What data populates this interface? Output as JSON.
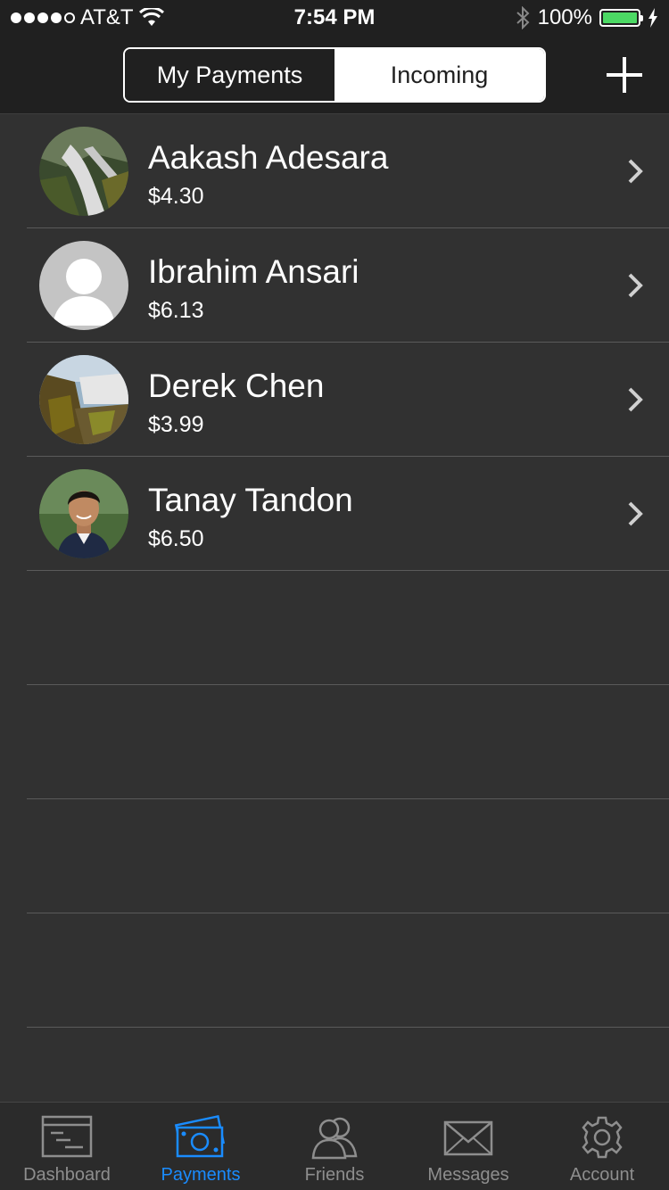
{
  "status_bar": {
    "carrier": "AT&T",
    "time": "7:54 PM",
    "battery": "100%",
    "battery_level": 1.0
  },
  "nav": {
    "segments": [
      "My Payments",
      "Incoming"
    ],
    "selected_segment": "Incoming",
    "add_icon": "plus-icon"
  },
  "payments": [
    {
      "name": "Aakash Adesara",
      "amount": "$4.30",
      "avatar": "waterfall-photo"
    },
    {
      "name": "Ibrahim Ansari",
      "amount": "$6.13",
      "avatar": "default-person"
    },
    {
      "name": "Derek Chen",
      "amount": "$3.99",
      "avatar": "waterfall-photo"
    },
    {
      "name": "Tanay Tandon",
      "amount": "$6.50",
      "avatar": "person-photo"
    }
  ],
  "tabs": [
    {
      "label": "Dashboard",
      "icon": "dashboard-icon",
      "active": false
    },
    {
      "label": "Payments",
      "icon": "payments-icon",
      "active": true
    },
    {
      "label": "Friends",
      "icon": "friends-icon",
      "active": false
    },
    {
      "label": "Messages",
      "icon": "messages-icon",
      "active": false
    },
    {
      "label": "Account",
      "icon": "gear-icon",
      "active": false
    }
  ],
  "colors": {
    "accent": "#1a8cff",
    "background": "#313131",
    "bar_background": "#202020",
    "battery": "#4cd964"
  }
}
